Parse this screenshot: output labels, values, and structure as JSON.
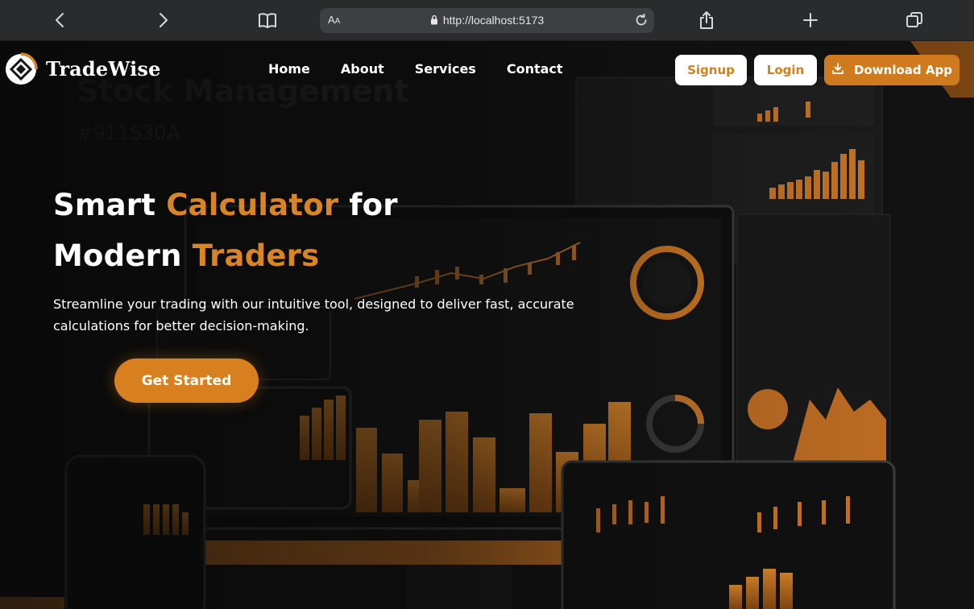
{
  "browser": {
    "aa_label_big": "A",
    "aa_label_small": "A",
    "url": "http://localhost:5173",
    "icons": [
      "back-icon",
      "forward-icon",
      "book-icon",
      "lock-icon",
      "reload-icon",
      "share-icon",
      "plus-icon",
      "tabs-icon"
    ]
  },
  "nav": {
    "brand": "TradeWise",
    "links": [
      "Home",
      "About",
      "Services",
      "Contact"
    ],
    "signup": "Signup",
    "login": "Login",
    "download": "Download App"
  },
  "hero": {
    "title_line1_a": "Smart ",
    "title_line1_accent": "Calculator",
    "title_line1_b": " for",
    "title_line2_a": "Modern ",
    "title_line2_accent": "Traders",
    "subtitle": "Streamline your trading with our intuitive tool, designed to deliver fast, accurate calculations for better decision-making.",
    "cta": "Get Started"
  },
  "colors": {
    "accent": "#d98427",
    "button_orange": "#cf7a1f",
    "chrome_bg": "#2a2b2d",
    "hero_bg": "#0d0d0d"
  }
}
